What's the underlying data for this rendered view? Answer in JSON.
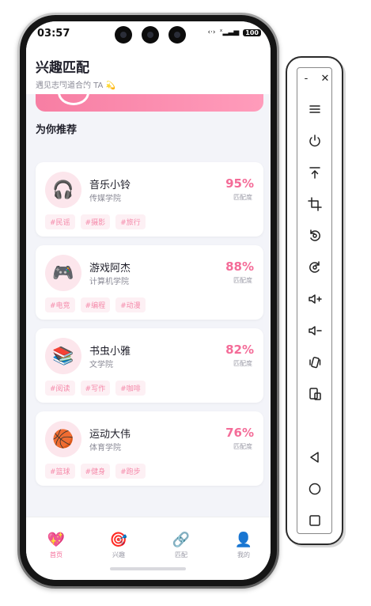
{
  "status": {
    "time": "03:57",
    "battery": "100"
  },
  "header": {
    "title": "兴趣匹配",
    "subtitle": "遇见志同道合的 TA 💫"
  },
  "section_title": "为你推荐",
  "cards": [
    {
      "name": "音乐小铃",
      "school": "传媒学院",
      "score": "95%",
      "score_label": "匹配度",
      "avatar_icon": "headphones-icon",
      "avatar_glyph": "🎧",
      "tags": [
        "#民谣",
        "#摄影",
        "#旅行"
      ]
    },
    {
      "name": "游戏阿杰",
      "school": "计算机学院",
      "score": "88%",
      "score_label": "匹配度",
      "avatar_icon": "gamepad-icon",
      "avatar_glyph": "🎮",
      "tags": [
        "#电竞",
        "#编程",
        "#动漫"
      ]
    },
    {
      "name": "书虫小雅",
      "school": "文学院",
      "score": "82%",
      "score_label": "匹配度",
      "avatar_icon": "books-icon",
      "avatar_glyph": "📚",
      "tags": [
        "#阅读",
        "#写作",
        "#咖啡"
      ]
    },
    {
      "name": "运动大伟",
      "school": "体育学院",
      "score": "76%",
      "score_label": "匹配度",
      "avatar_icon": "basketball-icon",
      "avatar_glyph": "🏀",
      "tags": [
        "#篮球",
        "#健身",
        "#跑步"
      ]
    }
  ],
  "tabs": [
    {
      "label": "首页",
      "icon": "heart-icon",
      "glyph": "💖",
      "active": true
    },
    {
      "label": "兴趣",
      "icon": "target-icon",
      "glyph": "🎯",
      "active": false
    },
    {
      "label": "匹配",
      "icon": "link-icon",
      "glyph": "🔗",
      "active": false
    },
    {
      "label": "我的",
      "icon": "user-icon",
      "glyph": "👤",
      "active": false
    }
  ],
  "toolbar": {
    "minimize": "-",
    "close": "✕",
    "buttons": [
      "menu-icon",
      "power-icon",
      "upload-icon",
      "crop-icon",
      "rotate-left-icon",
      "rotate-right-icon",
      "volume-up-icon",
      "volume-down-icon",
      "shake-icon",
      "screenshot-icon",
      "back-icon",
      "home-icon",
      "overview-icon"
    ]
  },
  "colors": {
    "accent": "#f46c98",
    "banner_start": "#f77ea3",
    "banner_end": "#ff9cbb",
    "tag_bg": "#fdf0f4",
    "avatar_bg": "#fce6ec"
  }
}
